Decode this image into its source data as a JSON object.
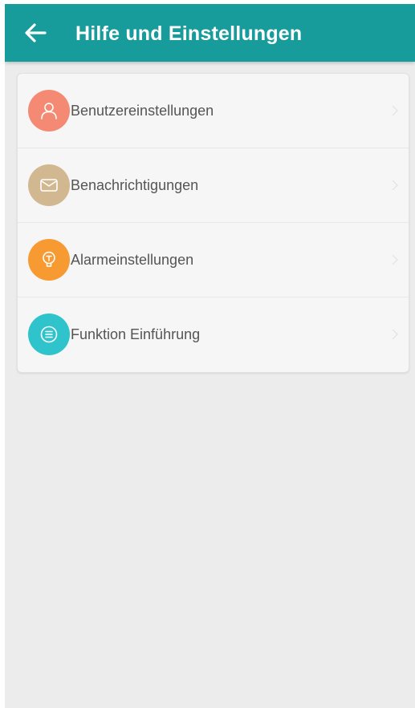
{
  "header": {
    "title": "Hilfe und Einstellungen",
    "back_icon": "arrow-left-icon",
    "background_color": "#179b9b"
  },
  "menu": {
    "items": [
      {
        "label": "Benutzereinstellungen",
        "icon": "user-icon",
        "color": "#f48a73"
      },
      {
        "label": "Benachrichtigungen",
        "icon": "envelope-icon",
        "color": "#d2b890"
      },
      {
        "label": "Alarmeinstellungen",
        "icon": "lightbulb-icon",
        "color": "#f79a32"
      },
      {
        "label": "Funktion Einführung",
        "icon": "list-icon",
        "color": "#2fc4cc"
      }
    ]
  }
}
